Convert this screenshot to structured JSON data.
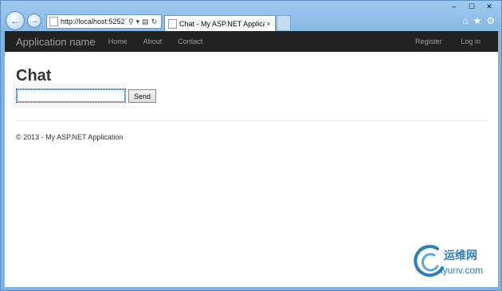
{
  "browser": {
    "url": "http://localhost:52527",
    "tab_title": "Chat - My ASP.NET Applica",
    "tab_close": "×",
    "back_glyph": "←",
    "forward_glyph": "→",
    "window_controls": [
      "–",
      "☐",
      "✕"
    ],
    "tool_icons": [
      "home-icon",
      "star-icon",
      "gear-icon"
    ]
  },
  "navbar": {
    "brand": "Application name",
    "links": [
      "Home",
      "About",
      "Contact"
    ],
    "right_links": [
      "Register",
      "Log in"
    ]
  },
  "main": {
    "title": "Chat",
    "message_input_value": "",
    "send_label": "Send"
  },
  "footer": {
    "text": "© 2013 - My ASP.NET Application"
  },
  "watermark": {
    "brand": "运维网",
    "domain": "iyunv.com"
  },
  "colors": {
    "navbar_bg": "#222222",
    "nav_text": "#9d9d9d",
    "chrome_blue": "#86b9e6"
  }
}
